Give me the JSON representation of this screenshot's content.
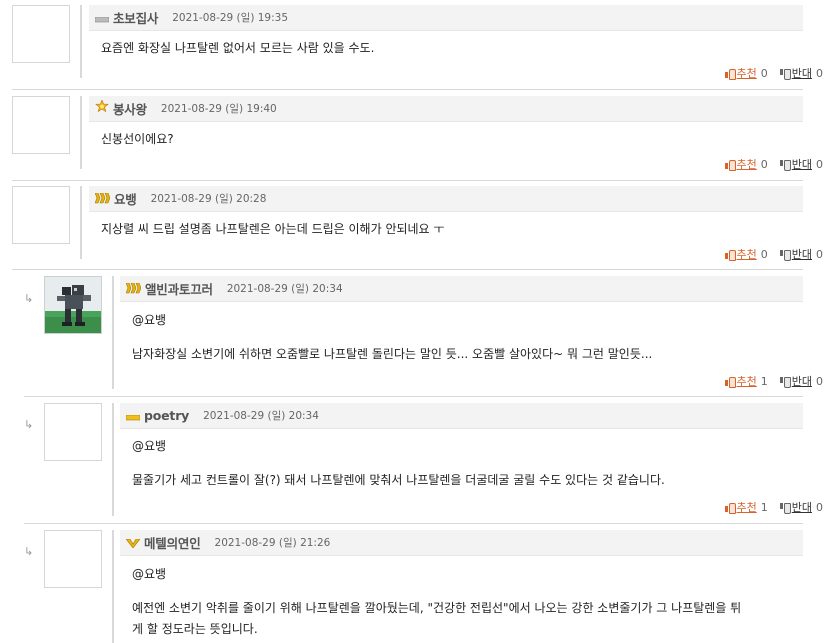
{
  "vote_labels": {
    "up": "추천",
    "down": "반대"
  },
  "reply_arrow": "↳",
  "comments": [
    {
      "nick": "초보집사",
      "date": "2021-08-29 (일) 19:35",
      "lines": [
        "요즘엔 화장실 나프탈렌 없어서 모르는 사람 있을 수도."
      ],
      "up": "0",
      "down": "0",
      "badge": "level-bar"
    },
    {
      "nick": "봉사왕",
      "date": "2021-08-29 (일) 19:40",
      "lines": [
        "신봉선이에요?"
      ],
      "up": "0",
      "down": "0",
      "badge": "sun-medal"
    },
    {
      "nick": "요뱅",
      "date": "2021-08-29 (일) 20:28",
      "lines": [
        "지상렬 씨 드립 설명좀 나프탈렌은 아는데 드립은 이해가 안되네요 ㅜ"
      ],
      "up": "0",
      "down": "0",
      "badge": "gold-chevrons"
    },
    {
      "nick": "앨빈과토끄러",
      "date": "2021-08-29 (일) 20:34",
      "lines": [
        "@요뱅",
        "남자화장실 소변기에 쉬하면 오줌빨로 나프탈렌 돌린다는 말인 듯... 오줌빨 살아있다~ 뭐 그런 말인듯..."
      ],
      "up": "1",
      "down": "0",
      "badge": "gold-chevrons",
      "reply": true,
      "avatar": "robot-figure"
    },
    {
      "nick": "poetry",
      "date": "2021-08-29 (일) 20:34",
      "lines": [
        "@요뱅",
        "물줄기가 세고 컨트롤이 잘(?) 돼서 나프탈렌에 맞춰서 나프탈렌을 더굴데굴 굴릴 수도 있다는 것 같습니다."
      ],
      "up": "1",
      "down": "0",
      "badge": "gold-bar",
      "reply": true
    },
    {
      "nick": "메텔의연인",
      "date": "2021-08-29 (일) 21:26",
      "lines": [
        "@요뱅",
        "예전엔 소변기 악취를 줄이기 위해 나프탈렌을 깔아뒀는데, \"건강한 전립선\"에서 나오는 강한 소변줄기가 그 나프탈렌을 튀",
        "게 할 정도라는 뜻입니다."
      ],
      "up": "",
      "down": "",
      "badge": "gold-v",
      "reply": true
    }
  ]
}
